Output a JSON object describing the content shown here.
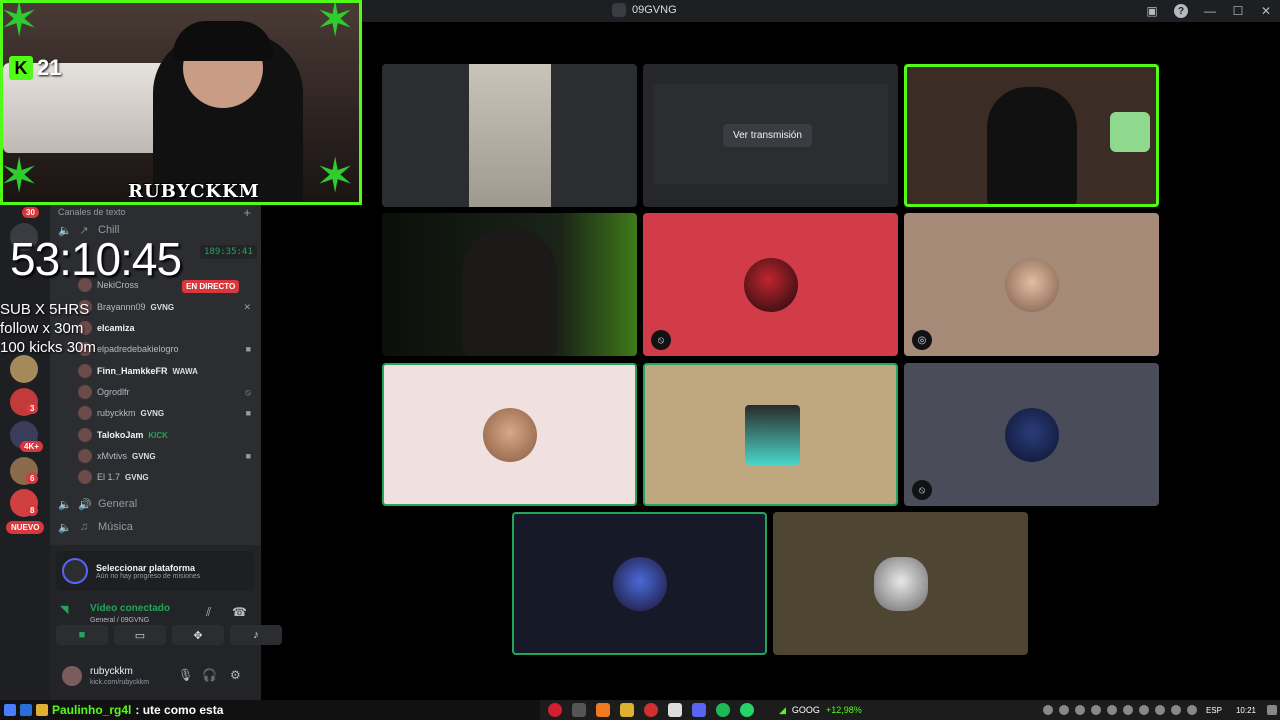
{
  "window": {
    "title": "09GVNG"
  },
  "webcam": {
    "kick_count": "21",
    "name_overlay": "RUBYCKKM"
  },
  "overlays": {
    "timer": "53:10:45",
    "goals": [
      "SUB X 5HRS",
      "follow x 30m",
      "100 kicks 30m"
    ]
  },
  "rail": {
    "badges": [
      "30",
      "3",
      "4K+",
      "6",
      "8"
    ],
    "nuevo": "NUEVO"
  },
  "channels": {
    "header": "Canales de texto",
    "chill": "Chill",
    "general": "General",
    "musica": "Música",
    "live_label": "EN DIRECTO",
    "call_time": "189:35:41",
    "voice_users": [
      {
        "name": "NekiCross",
        "tag": ""
      },
      {
        "name": "Brayannn09",
        "tag": "GVNG"
      },
      {
        "name": "elcamiza",
        "tag": ""
      },
      {
        "name": "elpadredebakielogro",
        "tag": ""
      },
      {
        "name": "Finn_HamkkeFR",
        "tag": "WAWA"
      },
      {
        "name": "Ogrodlfr",
        "tag": ""
      },
      {
        "name": "rubyckkm",
        "tag": "GVNG"
      },
      {
        "name": "TalokoJam",
        "tag": "KICK"
      },
      {
        "name": "xMvtivs",
        "tag": "GVNG"
      },
      {
        "name": "El 1.7",
        "tag": "GVNG"
      }
    ]
  },
  "panel": {
    "platform_title": "Seleccionar plataforma",
    "platform_sub": "Aún no hay progreso de misiones",
    "video_connected": "Vídeo conectado",
    "video_location": "General / 09GVNG",
    "username": "rubyckkm",
    "user_status": "kick.com/rubyckkm"
  },
  "grid": {
    "watch_stream": "Ver transmisión",
    "tile_colors": {
      "red": "#d13c48",
      "tan": "#a68a78",
      "pink": "#f0e0df",
      "gold": "#bfa880",
      "slate": "#4a4d59",
      "navy": "#161a28",
      "olive": "#4e4533"
    }
  },
  "chat": {
    "user": "Paulinho_rg4l",
    "message": ": ute como esta"
  },
  "taskbar": {
    "stock_symbol": "GOOG",
    "stock_change": "+12,98%",
    "lang": "ESP",
    "time": "10:21"
  }
}
